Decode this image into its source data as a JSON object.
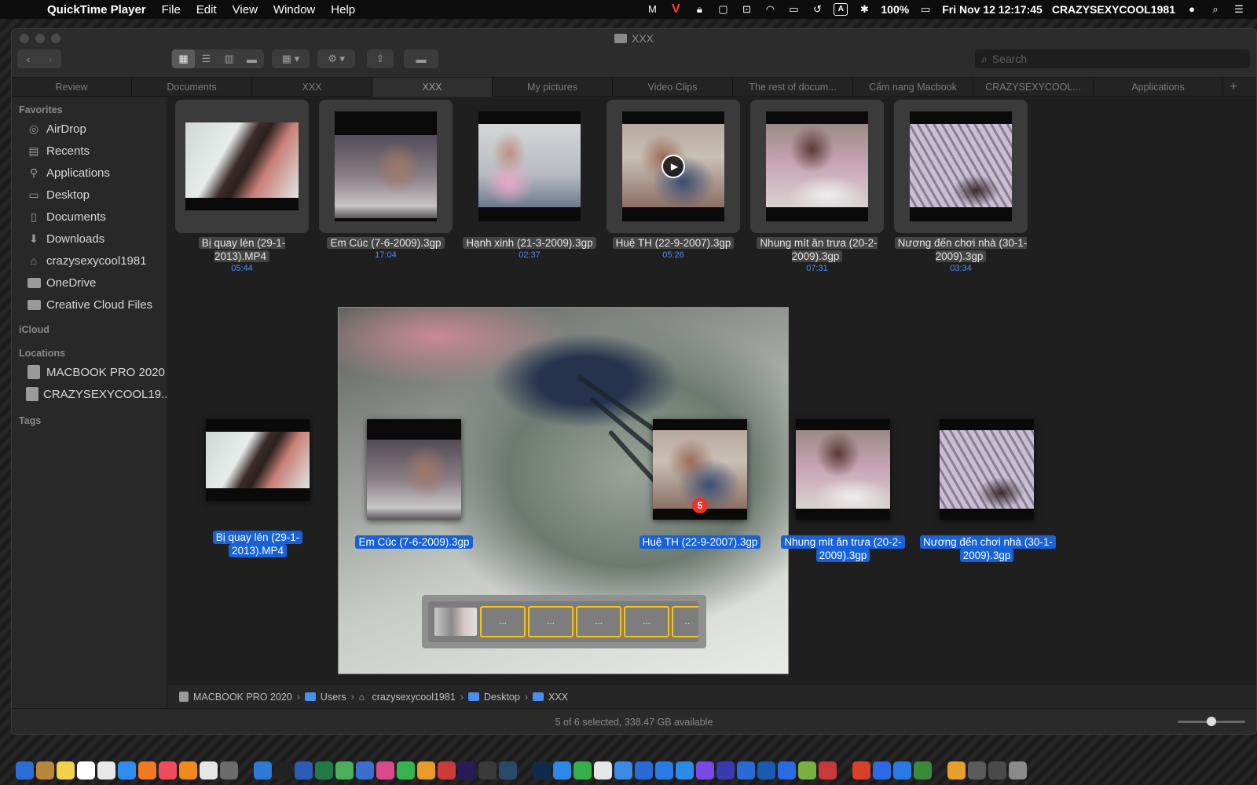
{
  "menubar": {
    "app_name": "QuickTime Player",
    "menus": [
      "File",
      "Edit",
      "View",
      "Window",
      "Help"
    ],
    "status_icons": [
      "mail-icon",
      "vivaldi-icon",
      "lock-icon",
      "window-icon",
      "cast-icon",
      "wifi-icon",
      "airplay-icon",
      "time-machine-icon",
      "input-source-icon",
      "bluetooth-icon"
    ],
    "input_source_label": "A",
    "battery": "100%",
    "clock": "Fri Nov 12  12:17:45",
    "user": "CRAZYSEXYCOOL1981"
  },
  "window": {
    "title": "XXX",
    "search_placeholder": "Search",
    "tabs": [
      "Review",
      "Documents",
      "XXX",
      "XXX",
      "My pictures",
      "Video Clips",
      "The rest of docum...",
      "Cẩm nang Macbook",
      "CRAZYSEXYCOOL...",
      "Applications"
    ],
    "active_tab": 3
  },
  "sidebar": {
    "favorites_heading": "Favorites",
    "favorites": [
      {
        "label": "AirDrop",
        "icon": "airdrop-icon"
      },
      {
        "label": "Recents",
        "icon": "recents-icon"
      },
      {
        "label": "Applications",
        "icon": "applications-icon"
      },
      {
        "label": "Desktop",
        "icon": "desktop-icon"
      },
      {
        "label": "Documents",
        "icon": "documents-icon"
      },
      {
        "label": "Downloads",
        "icon": "downloads-icon"
      },
      {
        "label": "crazysexycool1981",
        "icon": "home-icon"
      },
      {
        "label": "OneDrive",
        "icon": "folder-icon"
      },
      {
        "label": "Creative Cloud Files",
        "icon": "folder-icon"
      }
    ],
    "icloud_heading": "iCloud",
    "locations_heading": "Locations",
    "locations": [
      {
        "label": "MACBOOK PRO 2020",
        "icon": "drive-icon"
      },
      {
        "label": "CRAZYSEXYCOOL19...",
        "icon": "drive-icon"
      }
    ],
    "tags_heading": "Tags"
  },
  "files": [
    {
      "name": "Bị quay lén (29-1-2013).MP4",
      "duration": "05:44"
    },
    {
      "name": "Em Cúc (7-6-2009).3gp",
      "duration": "17:04"
    },
    {
      "name": "Hạnh xinh (21-3-2009).3gp",
      "duration": "02:37"
    },
    {
      "name": "Huệ TH (22-9-2007).3gp",
      "duration": "05:26"
    },
    {
      "name": "Nhung mít ăn trưa (20-2-2009).3gp",
      "duration": "07:31"
    },
    {
      "name": "Nương đến chơi nhà (30-1-2009).3gp",
      "duration": "03:34"
    }
  ],
  "dragged": [
    {
      "name": "Bị quay lén (29-1-2013).MP4"
    },
    {
      "name": "Em Cúc (7-6-2009).3gp"
    },
    {
      "name": "Huệ TH (22-9-2007).3gp"
    },
    {
      "name": "Nhung mít ăn trưa (20-2-2009).3gp"
    },
    {
      "name": "Nương đến chơi nhà (30-1-2009).3gp"
    }
  ],
  "drag_count": "5",
  "filmstrip_frames": [
    "...",
    "...",
    "...",
    "...",
    ".."
  ],
  "pathbar": [
    "MACBOOK PRO 2020",
    "Users",
    "crazysexycool1981",
    "Desktop",
    "XXX"
  ],
  "status": "5 of 6 selected, 338.47 GB available",
  "zoom_level": 0.5,
  "dock_apps": [
    "finder",
    "notes",
    "stickies",
    "calendar",
    "photos",
    "app-store",
    "books",
    "music",
    "vlc",
    "textedit",
    "system-preferences",
    "teamviewer",
    "terminal",
    "word",
    "excel",
    "maps",
    "keynote",
    "launchpad",
    "numbers",
    "pages-alt",
    "pdf-viewer",
    "premiere-pro",
    "video-editor",
    "lightroom",
    "photoshop",
    "safari",
    "evernote",
    "chrome",
    "pages",
    "skype",
    "zalo",
    "zoom",
    "messenger",
    "instastats",
    "translate",
    "1password",
    "teamviewer-alt",
    "android-studio",
    "pdf-expert",
    "app-alt",
    "bluetooth",
    "zalo-alt",
    "chrome-alt",
    "app-badge",
    "screenshot",
    "screen-recorder",
    "trash"
  ]
}
